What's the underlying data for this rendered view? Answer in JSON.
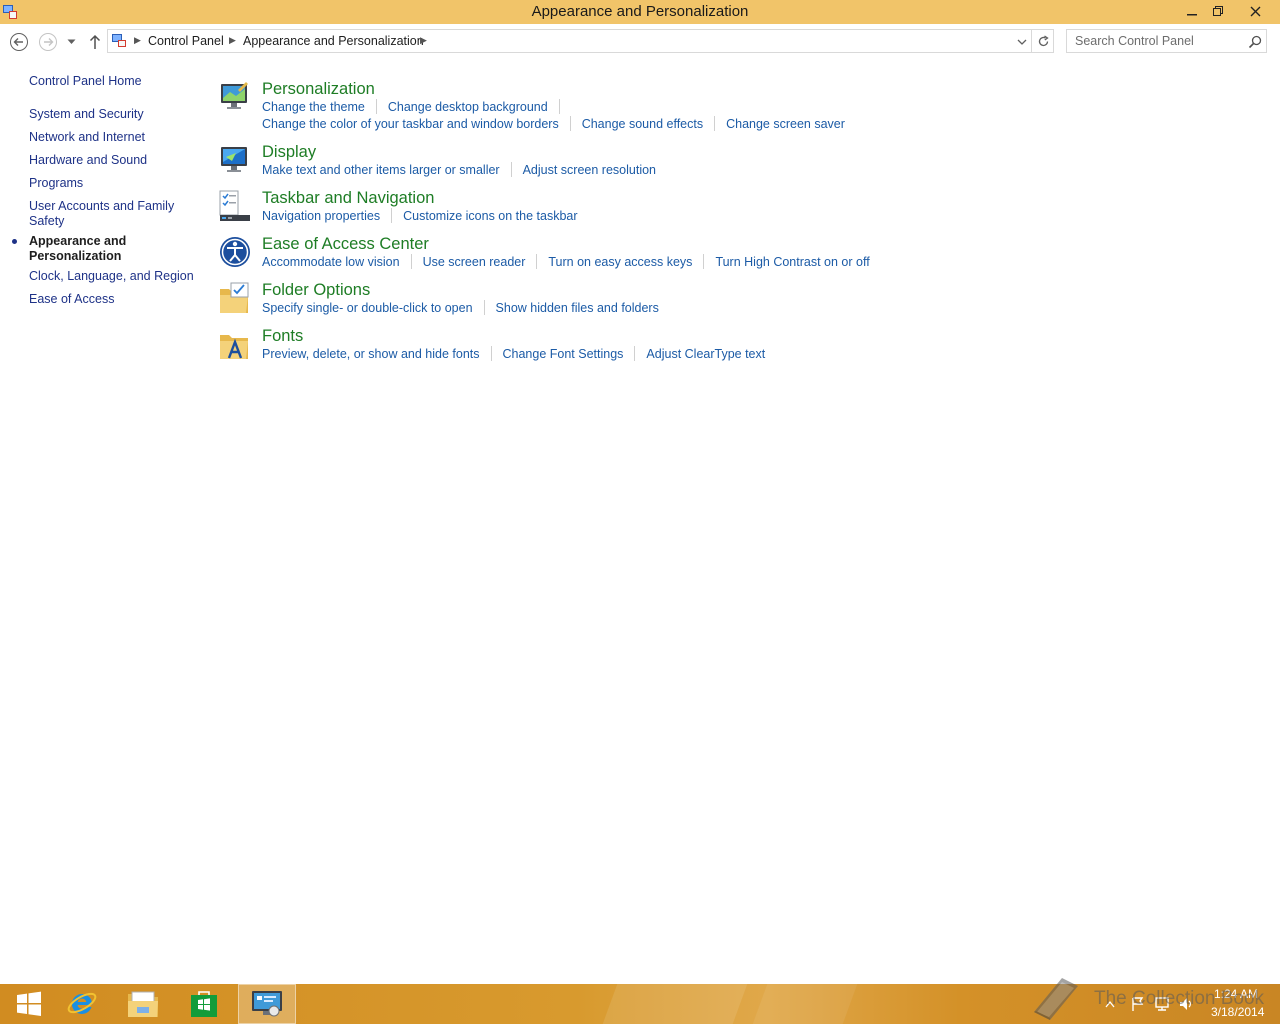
{
  "window": {
    "title": "Appearance and Personalization"
  },
  "address": {
    "breadcrumbs": [
      "Control Panel",
      "Appearance and Personalization"
    ],
    "search_placeholder": "Search Control Panel"
  },
  "sidebar": {
    "items": [
      {
        "label": "Control Panel Home"
      },
      {
        "label": "System and Security"
      },
      {
        "label": "Network and Internet"
      },
      {
        "label": "Hardware and Sound"
      },
      {
        "label": "Programs"
      },
      {
        "label": "User Accounts and Family Safety"
      },
      {
        "label": "Appearance and Personalization",
        "current": true
      },
      {
        "label": "Clock, Language, and Region"
      },
      {
        "label": "Ease of Access"
      }
    ]
  },
  "categories": [
    {
      "title": "Personalization",
      "icon": "personalization-icon",
      "rows": [
        [
          "Change the theme",
          "Change desktop background"
        ],
        [
          "Change the color of your taskbar and window borders",
          "Change sound effects",
          "Change screen saver"
        ]
      ]
    },
    {
      "title": "Display",
      "icon": "display-icon",
      "rows": [
        [
          "Make text and other items larger or smaller",
          "Adjust screen resolution"
        ]
      ]
    },
    {
      "title": "Taskbar and Navigation",
      "icon": "taskbar-navigation-icon",
      "rows": [
        [
          "Navigation properties",
          "Customize icons on the taskbar"
        ]
      ]
    },
    {
      "title": "Ease of Access Center",
      "icon": "ease-of-access-icon",
      "rows": [
        [
          "Accommodate low vision",
          "Use screen reader",
          "Turn on easy access keys",
          "Turn High Contrast on or off"
        ]
      ]
    },
    {
      "title": "Folder Options",
      "icon": "folder-options-icon",
      "rows": [
        [
          "Specify single- or double-click to open",
          "Show hidden files and folders"
        ]
      ]
    },
    {
      "title": "Fonts",
      "icon": "fonts-icon",
      "rows": [
        [
          "Preview, delete, or show and hide fonts",
          "Change Font Settings",
          "Adjust ClearType text"
        ]
      ]
    }
  ],
  "taskbar": {
    "items": [
      {
        "name": "start-button",
        "icon": "windows-logo-icon"
      },
      {
        "name": "internet-explorer",
        "icon": "ie-icon"
      },
      {
        "name": "file-explorer",
        "icon": "folder-icon"
      },
      {
        "name": "store",
        "icon": "store-icon"
      },
      {
        "name": "control-panel",
        "icon": "control-panel-icon",
        "active": true
      }
    ],
    "clock": {
      "time": "1:24 AM",
      "date": "3/18/2014"
    },
    "watermark": "The Collection Book"
  },
  "colors": {
    "titlebar": "#f1c469",
    "category_title": "#1e7d25",
    "task_link": "#1c5ba6",
    "sidebar_link": "#1e3287"
  }
}
